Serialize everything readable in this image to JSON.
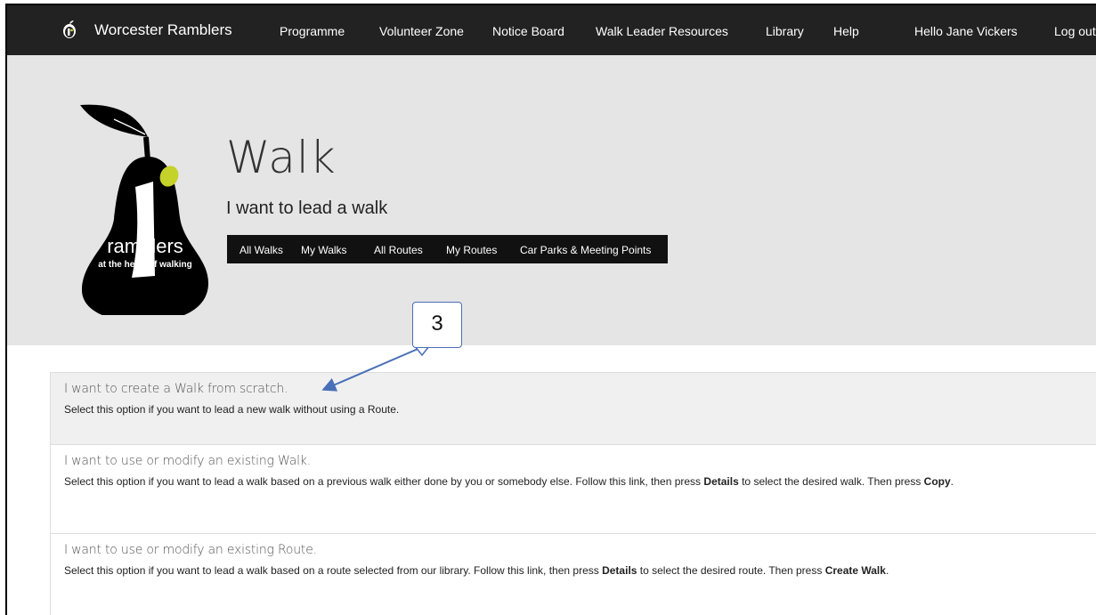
{
  "navbar": {
    "brand": "Worcester Ramblers",
    "items": [
      "Programme",
      "Volunteer Zone",
      "Notice Board",
      "Walk Leader Resources",
      "Library",
      "Help"
    ],
    "greeting": "Hello Jane Vickers",
    "logout": "Log out"
  },
  "logo": {
    "wordmark": "ramblers",
    "tagline": "at the heart of walking"
  },
  "page": {
    "title": "Walk",
    "subtitle": "I want to lead a walk"
  },
  "subnav": {
    "items": [
      "All Walks",
      "My Walks",
      "All Routes",
      "My Routes",
      "Car Parks & Meeting Points"
    ]
  },
  "options": [
    {
      "heading": "I want to create a Walk from scratch.",
      "text": "Select this option if you want to lead a new walk without using a Route."
    },
    {
      "heading": "I want to use or modify an existing Walk.",
      "text_a": "Select this option if you want to lead a walk based on a previous walk either done by you or somebody else. Follow this link, then press ",
      "bold_a": "Details",
      "text_b": " to select the desired walk. Then press ",
      "bold_b": "Copy",
      "text_c": "."
    },
    {
      "heading": "I want to use or modify an existing Route.",
      "text_a": "Select this option if you want to lead a walk based on a route selected from our library. Follow this link, then press ",
      "bold_a": "Details",
      "text_b": " to select the desired route. Then press ",
      "bold_b": "Create Walk",
      "text_c": "."
    }
  ],
  "callout": {
    "label": "3"
  },
  "colors": {
    "navbar": "#222222",
    "hero": "#e5e5e5",
    "callout_border": "#4a6fb8",
    "pear_leaf": "#c4d22a"
  }
}
